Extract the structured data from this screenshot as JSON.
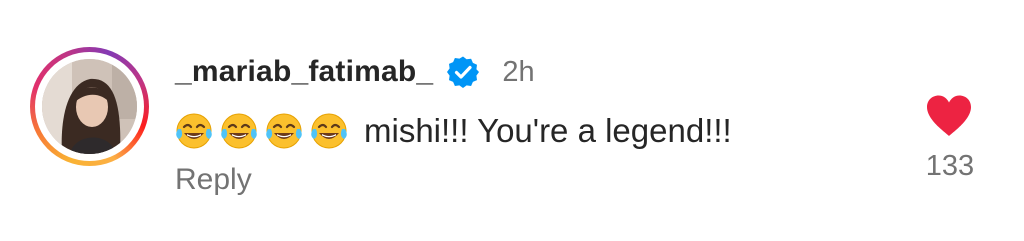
{
  "comment": {
    "username": "_mariab_fatimab_",
    "verified_icon": "verified-badge-icon",
    "timestamp": "2h",
    "emojis": [
      "face-with-tears-of-joy",
      "face-with-tears-of-joy",
      "face-with-tears-of-joy",
      "face-with-tears-of-joy"
    ],
    "text": "mishi!!! You're a legend!!!",
    "reply_label": "Reply",
    "like_icon": "heart-icon",
    "liked": true,
    "like_count": "133"
  },
  "colors": {
    "heart": "#ed2342",
    "verified": "#0095f6",
    "username": "#262626",
    "muted": "#737373"
  }
}
